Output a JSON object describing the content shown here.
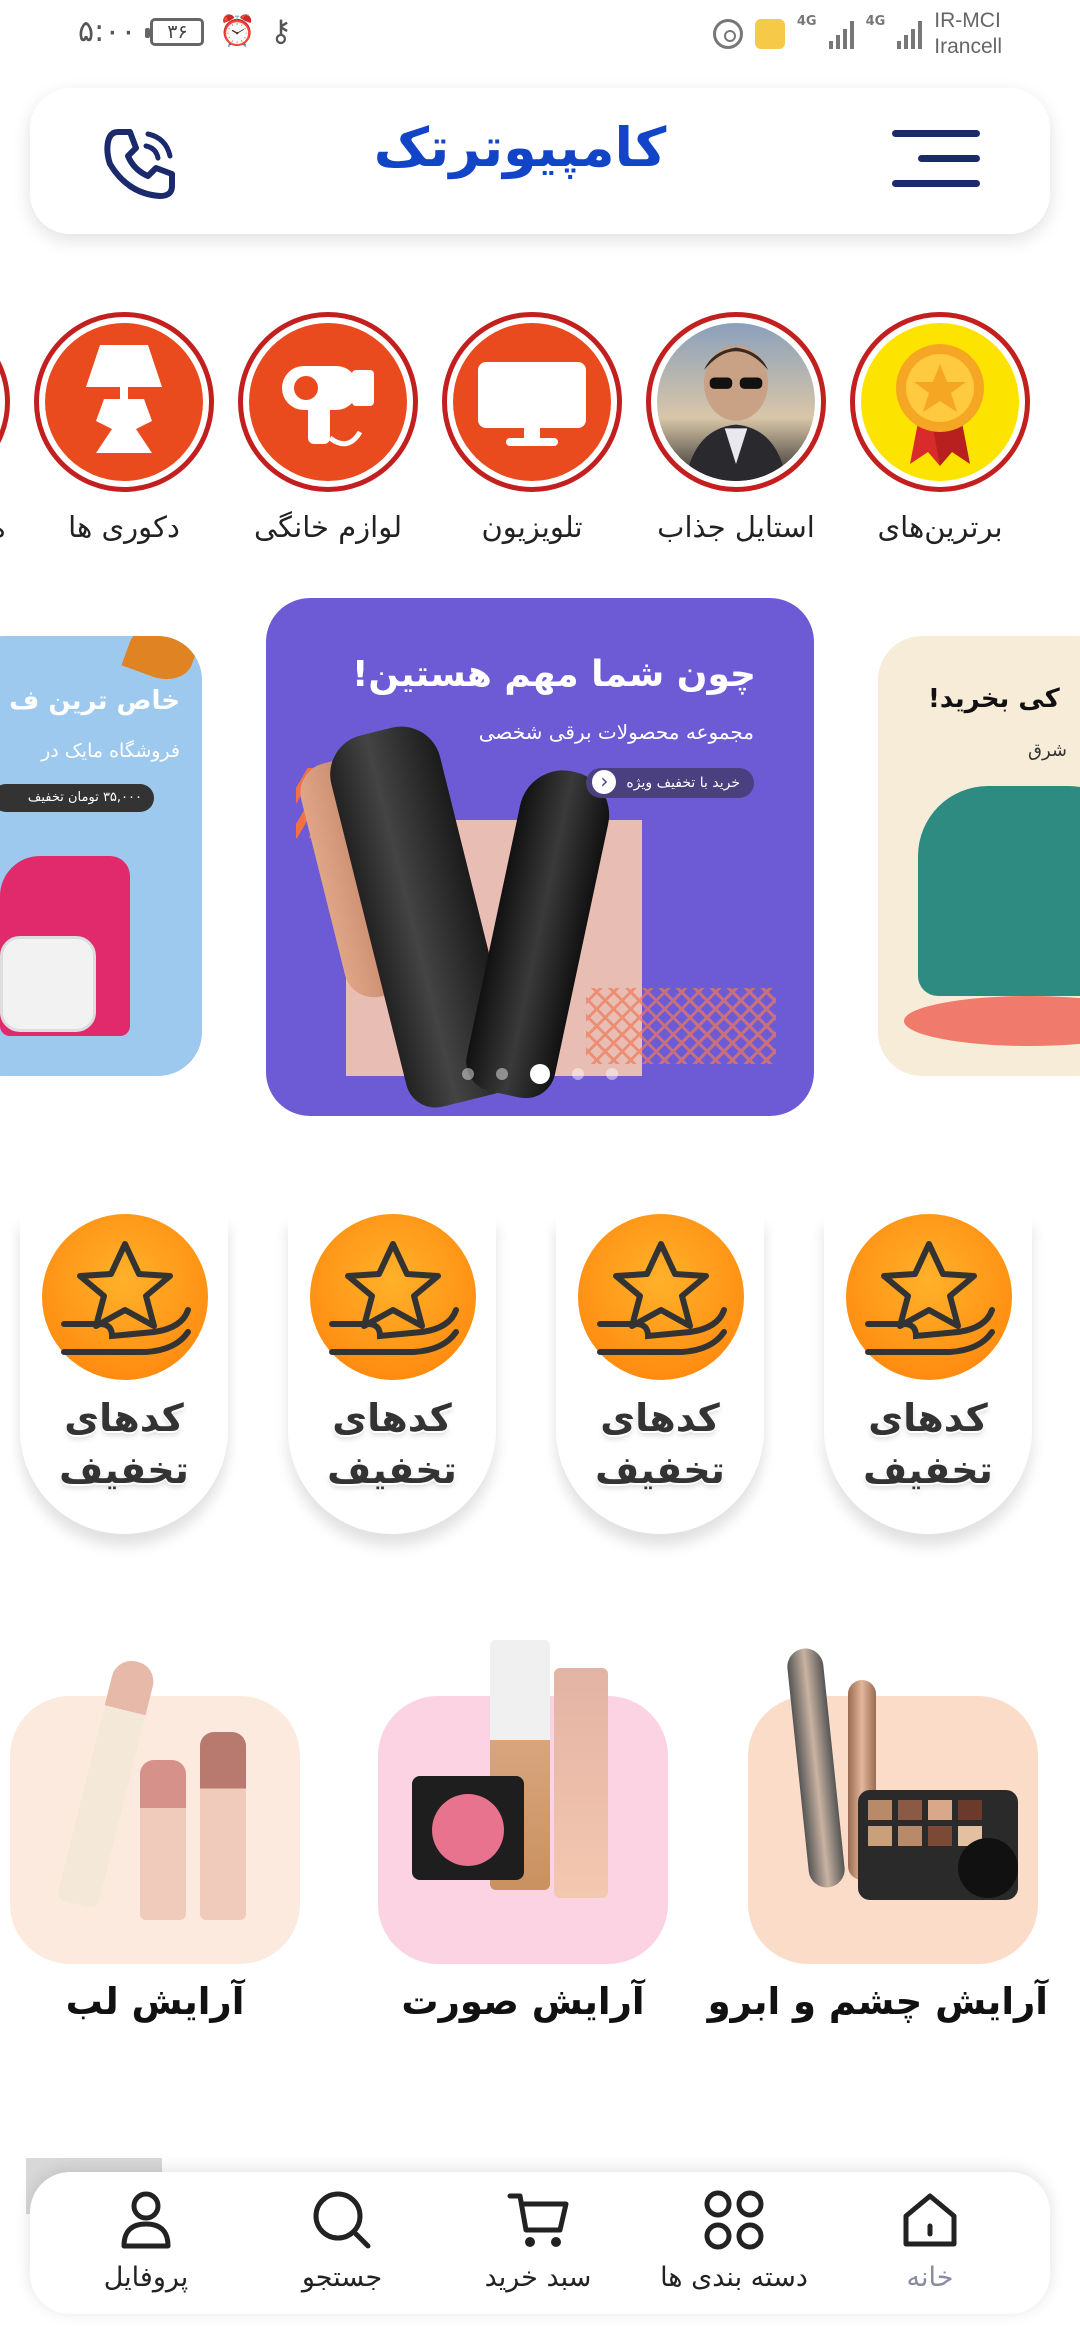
{
  "status_bar": {
    "time": "۵:۰۰",
    "battery": "۳۶",
    "carrier_1": "IR-MCI",
    "carrier_2": "Irancell",
    "network_1": "4G",
    "network_2": "4G"
  },
  "header": {
    "logo": "کامپیوترتک"
  },
  "categories": [
    {
      "label": "برترین‌های"
    },
    {
      "label": "استایل جذاب"
    },
    {
      "label": "تلویزیون"
    },
    {
      "label": "لوازم خانگی"
    },
    {
      "label": "دکوری ها"
    },
    {
      "label": "ه"
    }
  ],
  "slider": {
    "main": {
      "title": "چون شما مهم هستین!",
      "subtitle": "مجموعه محصولات برقی شخصی",
      "cta": "خرید با تخفیف ویژه"
    },
    "left": {
      "title": "خاص ترین ف",
      "subtitle": "فروشگاه مایک در",
      "cta": "۳۵,۰۰۰ تومان تخفیف"
    },
    "right": {
      "title": "کی بخرید!",
      "subtitle": "شرق"
    },
    "active_dot": 3,
    "dot_count": 5
  },
  "discount_codes": [
    {
      "label": "کدهای\nتخفیف"
    },
    {
      "label": "کدهای\nتخفیف"
    },
    {
      "label": "کدهای\nتخفیف"
    },
    {
      "label": "کدهای\nتخفیف"
    }
  ],
  "makeup": [
    {
      "label": "آرایش چشم و ابرو",
      "color": "#fbdcc8"
    },
    {
      "label": "آرایش صورت",
      "color": "#fbd3e3"
    },
    {
      "label": "آرایش لب",
      "color": "#fdeadf"
    }
  ],
  "bottom_nav": [
    {
      "label": "خانه"
    },
    {
      "label": "دسته بندی ها"
    },
    {
      "label": "سبد خرید"
    },
    {
      "label": "جستجو"
    },
    {
      "label": "پروفایل"
    }
  ],
  "colors": {
    "brand": "#1244c8",
    "category_ring": "#c31f1f",
    "category_fill": "#e94a1e",
    "slide_main": "#6d5bd6",
    "discount_orange": "#ff8f12"
  }
}
